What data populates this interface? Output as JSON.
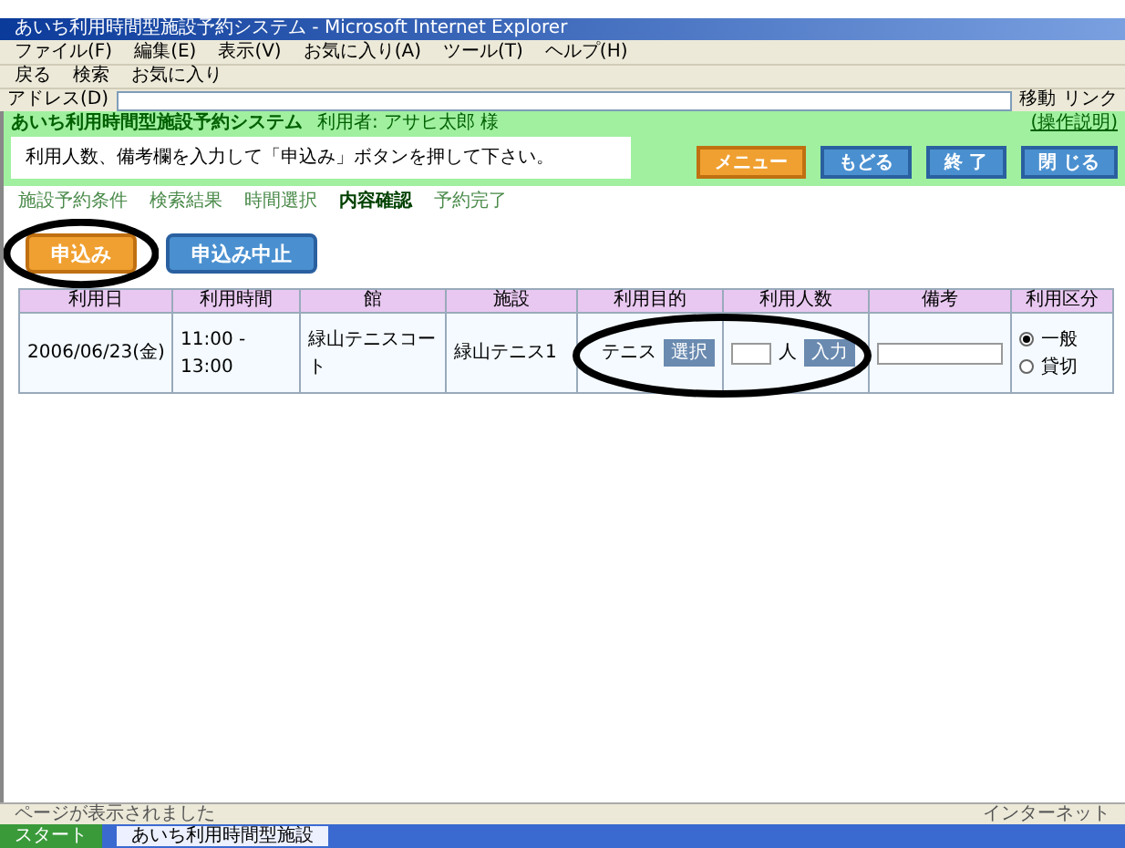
{
  "window": {
    "title": "あいち利用時間型施設予約システム - Microsoft Internet Explorer"
  },
  "menu": [
    "ファイル(F)",
    "編集(E)",
    "表示(V)",
    "お気に入り(A)",
    "ツール(T)",
    "ヘルプ(H)"
  ],
  "toolbar": [
    "戻る",
    "検索",
    "お気に入り"
  ],
  "address": {
    "label": "アドレス(D)",
    "go": "移動",
    "links": "リンク"
  },
  "header": {
    "system_title": "あいち利用時間型施設予約システム",
    "user": "利用者: アサヒ太郎 様",
    "help_link": "(操作説明)",
    "message": "利用人数、備考欄を入力して「申込み」ボタンを押して下さい。"
  },
  "nav_buttons": [
    {
      "label": "メニュー",
      "kind": "orange"
    },
    {
      "label": "もどる",
      "kind": "blue"
    },
    {
      "label": "終 了",
      "kind": "blue"
    },
    {
      "label": "閉 じる",
      "kind": "blue"
    }
  ],
  "steps": [
    {
      "label": "施設予約条件",
      "selected": false
    },
    {
      "label": "検索結果",
      "selected": false
    },
    {
      "label": "時間選択",
      "selected": false
    },
    {
      "label": "内容確認",
      "selected": true
    },
    {
      "label": "予約完了",
      "selected": false
    }
  ],
  "actions": [
    {
      "label": "申込み",
      "kind": "orange"
    },
    {
      "label": "申込み中止",
      "kind": "blue"
    }
  ],
  "table": {
    "columns": [
      "利用日",
      "利用時間",
      "館",
      "施設",
      "利用目的",
      "利用人数",
      "備考",
      "利用区分"
    ],
    "row": {
      "date": "2006/06/23(金)",
      "time": "11:00 - 13:00",
      "building": "緑山テニスコート",
      "facility": "緑山テニス1",
      "purpose": "テニス",
      "purpose_button": "選択",
      "people_unit": "人",
      "people_button": "入力",
      "options": [
        {
          "label": "一般",
          "selected": true
        },
        {
          "label": "貸切",
          "selected": false
        }
      ]
    }
  },
  "status_bar": {
    "text": "ページが表示されました",
    "zone": "インターネット"
  },
  "taskbar": {
    "start": "スタート",
    "task": "あいち利用時間型施設"
  }
}
